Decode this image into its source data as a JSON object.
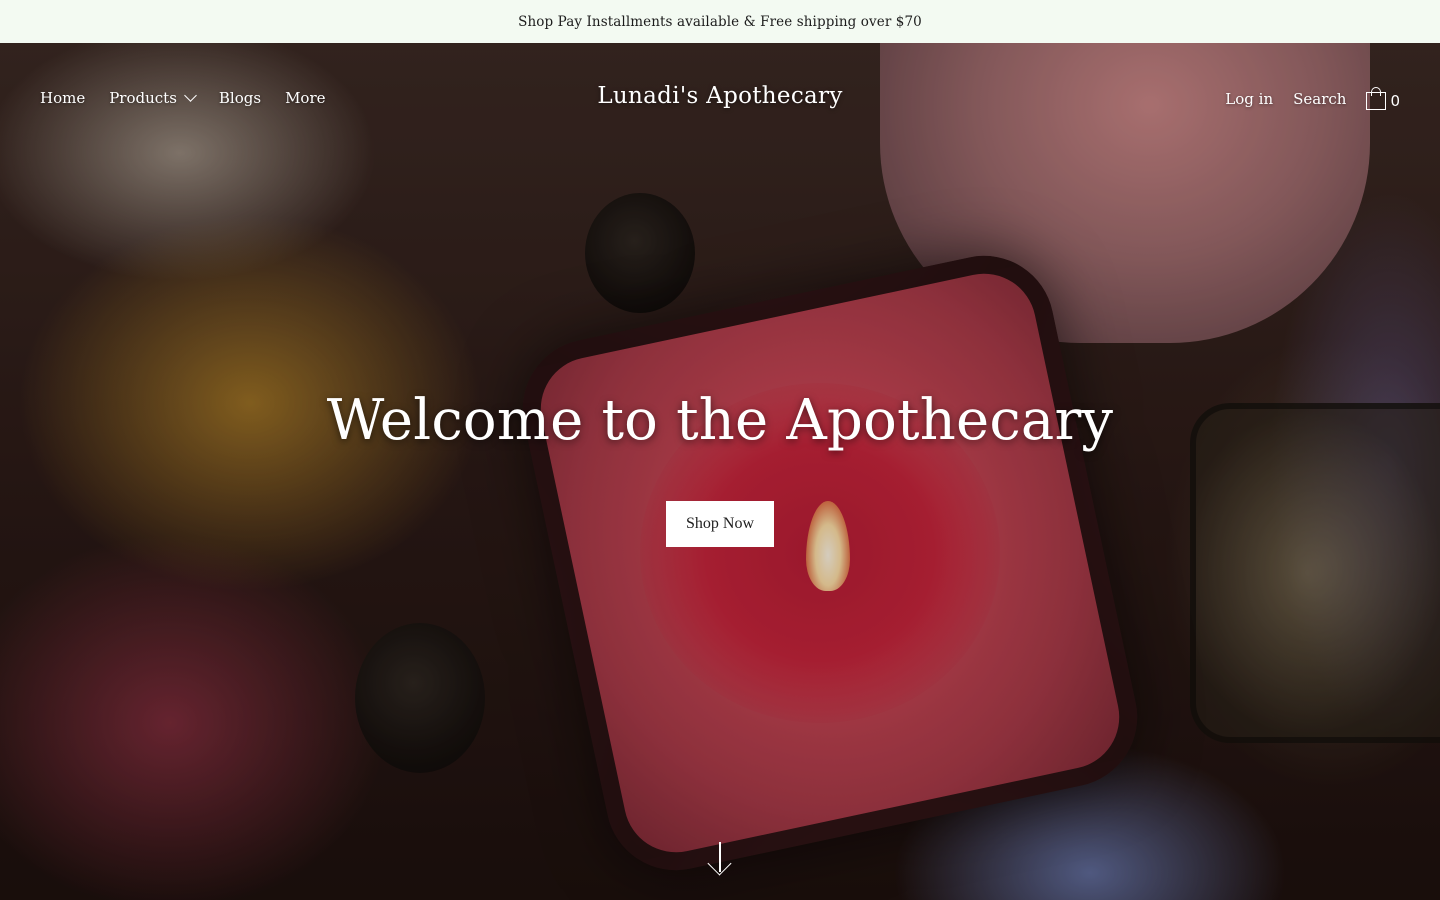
{
  "announcement": {
    "text": "Shop Pay Installments available & Free shipping over $70"
  },
  "header": {
    "nav": [
      {
        "label": "Home"
      },
      {
        "label": "Products"
      },
      {
        "label": "Blogs"
      },
      {
        "label": "More"
      }
    ],
    "brand": "Lunadi's Apothecary",
    "login_label": "Log in",
    "search_label": "Search",
    "cart_count": "0"
  },
  "hero": {
    "title": "Welcome to the Apothecary",
    "button_label": "Shop Now"
  },
  "icons": {
    "products_dropdown": "chevron-down-icon",
    "cart": "shopping-bag-icon",
    "scroll": "arrow-down-icon"
  }
}
